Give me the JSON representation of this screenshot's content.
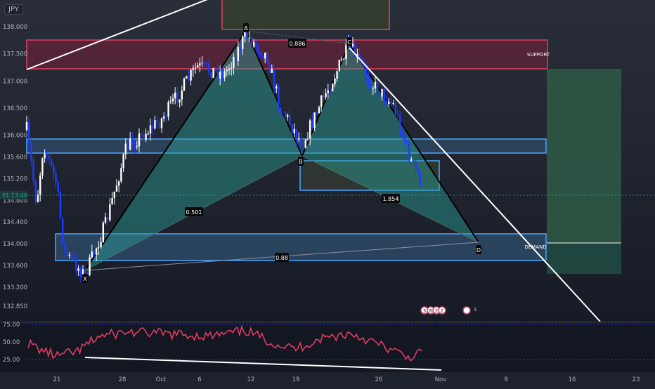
{
  "symbol": "JPY",
  "colors": {
    "bg_top": "#2a2e39",
    "bg_bottom": "#131722",
    "candle_up": "#ffffff",
    "candle_down": "#1e3cff",
    "pattern_fill": "#2aa198",
    "supply_fill": "#8a1c3a",
    "demand_fill": "#3d6e9c",
    "rsi_line": "#e03c64",
    "target_box": "#2e5a45"
  },
  "price_axis": {
    "ticks": [
      "138.000",
      "137.500",
      "137.000",
      "136.500",
      "136.000",
      "135.600",
      "135.200",
      "134.800",
      "134.400",
      "134.000",
      "133.600",
      "133.200",
      "132.850"
    ],
    "current_label": "01:13:46"
  },
  "date_axis": {
    "labels": [
      "21",
      "28",
      "Oct",
      "6",
      "12",
      "19",
      "26",
      "Nov",
      "9",
      "16",
      "23"
    ]
  },
  "rsi_axis": {
    "labels": [
      "75.00",
      "50.00",
      "25.00"
    ]
  },
  "pattern": {
    "points": {
      "X": "X",
      "A": "A",
      "B": "B",
      "C": "C",
      "D": "D"
    },
    "ratios": {
      "xb": "0.501",
      "ac": "0.886",
      "bd": "1.854",
      "xd": "0.88"
    }
  },
  "zones": {
    "support": "SUPPORT",
    "demand": "DEMAND"
  },
  "event_icons": [
    "3",
    "6",
    "2",
    "2",
    "3"
  ],
  "chart_data": {
    "type": "candlestick",
    "x_labels": [
      "21",
      "28",
      "Oct",
      "6",
      "12",
      "19",
      "26",
      "Nov",
      "9",
      "16",
      "23"
    ],
    "ylim": [
      132.85,
      138.1
    ],
    "pivots": [
      {
        "label": "X",
        "price": 133.5
      },
      {
        "label": "A",
        "price": 137.85
      },
      {
        "label": "B",
        "price": 135.3
      },
      {
        "label": "C",
        "price": 137.7
      },
      {
        "label": "D",
        "price": 133.9
      }
    ],
    "zones": [
      {
        "name": "SUPPORT",
        "from": 137.2,
        "to": 137.75
      },
      {
        "name": "DEMAND",
        "from": 133.6,
        "to": 134.1
      }
    ],
    "rsi": {
      "ylim": [
        25,
        75
      ],
      "levels": [
        75,
        50,
        25
      ]
    }
  }
}
